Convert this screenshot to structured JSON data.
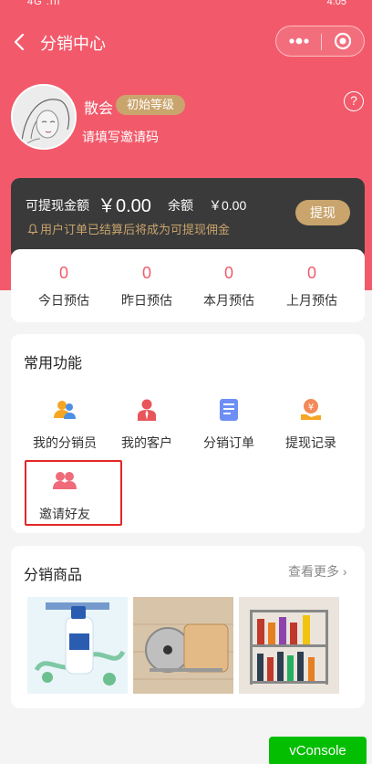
{
  "status_bar": {
    "left": "4G .ııl",
    "right": "4:05"
  },
  "nav": {
    "title": "分销中心"
  },
  "profile": {
    "name": "散会",
    "level": "初始等级",
    "invite_prompt": "填写邀请码"
  },
  "balance": {
    "withdrawable_label": "可提现金额",
    "withdrawable_amount": "￥0.00",
    "remaining_label": "余额",
    "remaining_amount": "￥0.00",
    "hint": "用户订单已结算后将成为可提现佣金",
    "withdraw_button": "提现"
  },
  "estimates": [
    {
      "value": "0",
      "label": "今日预估"
    },
    {
      "value": "0",
      "label": "昨日预估"
    },
    {
      "value": "0",
      "label": "本月预估"
    },
    {
      "value": "0",
      "label": "上月预估"
    }
  ],
  "functions": {
    "title": "常用功能",
    "items": [
      {
        "label": "我的分销员",
        "icon": "distributor-icon"
      },
      {
        "label": "我的客户",
        "icon": "customer-icon"
      },
      {
        "label": "分销订单",
        "icon": "order-icon"
      },
      {
        "label": "提现记录",
        "icon": "withdraw-record-icon"
      },
      {
        "label": "邀请好友",
        "icon": "invite-friends-icon"
      }
    ]
  },
  "products": {
    "title": "分销商品",
    "more": "查看更多",
    "items": [
      {
        "image": "shampoo-product-image"
      },
      {
        "image": "pot-lid-rack-image"
      },
      {
        "image": "spice-rack-image"
      }
    ]
  },
  "vconsole": {
    "label": "vConsole"
  }
}
